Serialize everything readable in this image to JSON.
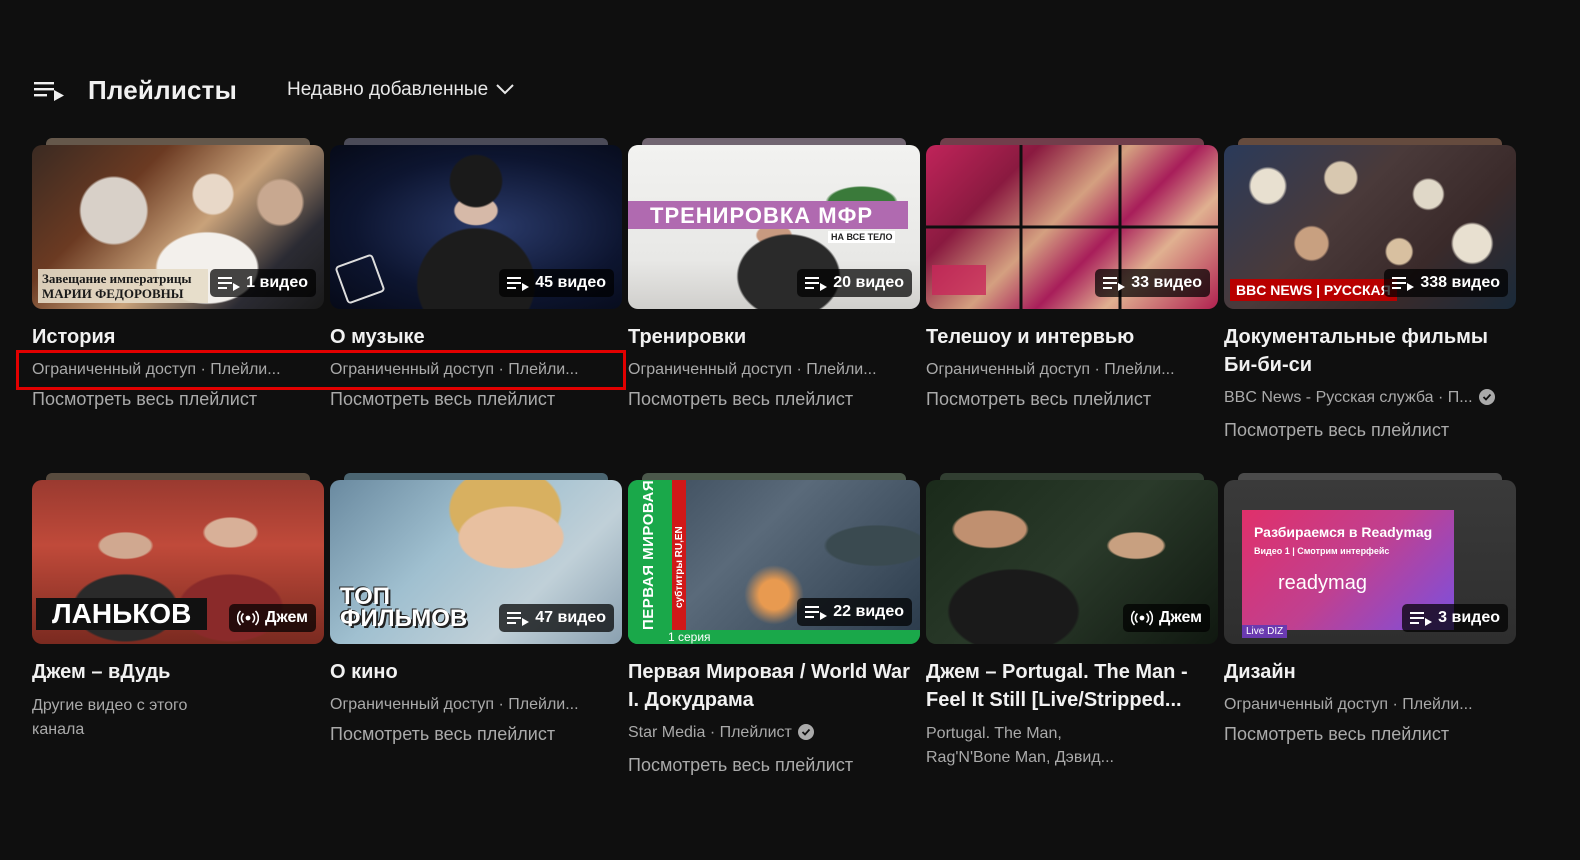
{
  "header": {
    "title": "Плейлисты",
    "sort_label": "Недавно добавленные"
  },
  "row1": [
    {
      "title": "История",
      "count": "1 видео",
      "meta": "Ограниченный доступ · Плейли...",
      "view_all": "Посмотреть весь плейлист",
      "thumb_text": "Завещание императрицы МАРИИ ФЕДОРОВНЫ"
    },
    {
      "title": "О музыке",
      "count": "45 видео",
      "meta": "Ограниченный доступ · Плейли...",
      "view_all": "Посмотреть весь плейлист"
    },
    {
      "title": "Тренировки",
      "count": "20 видео",
      "meta": "Ограниченный доступ · Плейли...",
      "view_all": "Посмотреть весь плейлист",
      "thumb_text": "ТРЕНИРОВКА МФР",
      "thumb_sub": "НА ВСЕ ТЕЛО"
    },
    {
      "title": "Телешоу и интервью",
      "count": "33 видео",
      "meta": "Ограниченный доступ · Плейли...",
      "view_all": "Посмотреть весь плейлист"
    },
    {
      "title": "Документальные фильмы Би-би-си",
      "count": "338 видео",
      "meta": "BBC News - Русская служба · П...",
      "view_all": "Посмотреть весь плейлист",
      "thumb_text": "BBC NEWS | РУССКАЯ"
    }
  ],
  "row2": [
    {
      "title": "Джем – вДудь",
      "count": "Джем",
      "meta": "Другие видео с этого канала",
      "thumb_text": "ЛАНЬКОВ"
    },
    {
      "title": "О кино",
      "count": "47 видео",
      "meta": "Ограниченный доступ · Плейли...",
      "view_all": "Посмотреть весь плейлист",
      "thumb_text": "ТОП ФИЛЬМОВ"
    },
    {
      "title": "Первая Мировая / World War I. Докудрама",
      "count": "22 видео",
      "meta": "Star Media · Плейлист",
      "view_all": "Посмотреть весь плейлист",
      "thumb_text": "ПЕРВАЯ МИРОВАЯ",
      "thumb_sub": "субтитры RU,EN",
      "thumb_sub2": "1 серия"
    },
    {
      "title": "Джем – Portugal. The Man - Feel It Still [Live/Stripped...",
      "count": "Джем",
      "meta": "Portugal. The Man, Rag'N'Bone Man, Дэвид..."
    },
    {
      "title": "Дизайн",
      "count": "3 видео",
      "meta": "Ограниченный доступ · Плейли...",
      "view_all": "Посмотреть весь плейлист",
      "thumb_text": "Разбираемся в Readymag",
      "thumb_sub": "Видео 1 | Смотрим интерфейс",
      "thumb_sub2": "readymag",
      "thumb_sub3": "Live DIZ"
    }
  ],
  "colors": {
    "background": "#0f0f0f",
    "highlight": "#e10000",
    "meta": "#aaaaaa"
  }
}
